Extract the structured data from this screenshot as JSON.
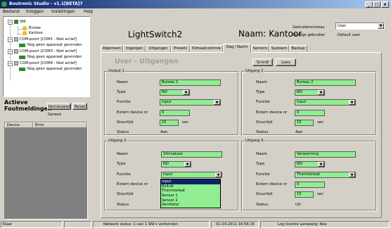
{
  "window": {
    "title": "Boutronic Studio - v1.1[BETA]7",
    "min_btn": "_",
    "max_btn": "□",
    "close_btn": "x"
  },
  "menu": [
    "Bestand",
    "Inloggen",
    "Instellingen",
    "Help"
  ],
  "tree": {
    "root": "SNI",
    "items": [
      {
        "label": "Entree"
      },
      {
        "label": "Kantoor"
      },
      {
        "label": "COM-poort [COM1 - Niet actief]"
      },
      {
        "label": "Nog geen apparaat gevonden"
      },
      {
        "label": "COM-poort [COM3 - Niet actief]"
      },
      {
        "label": "Nog geen apparaat gevonden"
      },
      {
        "label": "COM-poort [COM4 - Niet actief]"
      },
      {
        "label": "Nog geen apparaat gevonden"
      }
    ]
  },
  "alerts": {
    "title_line1": "Actieve",
    "title_line2": "Foutmeldingen",
    "refresh_label": "Vernieuwen",
    "reset_label": "Reset",
    "status": "Gereed",
    "columns": [
      "Device",
      "Error"
    ]
  },
  "header": {
    "device_name": "LightSwitch2",
    "naam": "Naam: Kantoor",
    "user_level_label": "Gebruikersniveau",
    "user_level_value": "User",
    "current_user_label": "Huidige gebruiker",
    "current_user_value": "Default user"
  },
  "tabs": [
    "Algemeen",
    "Ingangen",
    "Uitgangen",
    "Presets",
    "Klimaatcontrole",
    "Dag / Nacht",
    "Sensors",
    "Systeem",
    "Backup"
  ],
  "active_tab": "Dag / Nacht",
  "section": {
    "title": "User - Uitgangen",
    "write_label": "Schrijf",
    "read_label": "Lees"
  },
  "labels": {
    "naam": "Naam",
    "type": "Type",
    "functie": "Functie",
    "extern": "Extern device nr",
    "stuurtijd": "Stuurtijd",
    "status": "Status",
    "sec": "sec"
  },
  "outputs": [
    {
      "title": "Output 1",
      "naam": "Bureau 1",
      "type": "NO",
      "functie": "Input",
      "extern": "0",
      "stuurtijd": "15",
      "status": "Aan"
    },
    {
      "title": "Uitgang 2",
      "naam": "Bureau 2",
      "type": "NO",
      "functie": "Input",
      "extern": "0",
      "stuurtijd": "15",
      "status": "Aan"
    },
    {
      "title": "Uitgang 3",
      "naam": "Vitrinekast",
      "type": "NO",
      "functie": "Input",
      "extern": "",
      "stuurtijd": "",
      "status": ""
    },
    {
      "title": "Uitgang 4",
      "naam": "Verwarming",
      "type": "NO",
      "functie": "Thermostaat",
      "extern": "0",
      "stuurtijd": "15",
      "status": "Uit"
    }
  ],
  "functie_options": [
    "Input",
    "Rolluik",
    "Thermostaat",
    "Sensor 1",
    "Sensor 2",
    "Ventilator"
  ],
  "functie_selected": "Input",
  "statusbar": {
    "state": "Klaar",
    "network": "Netwerk status: 1 van 1 SNI's verbonden",
    "datetime": "01-03-2011 16:56:15",
    "license": "Log licentie aanwezig: Nee"
  },
  "colors": {
    "field_bg": "#90ee90",
    "titlebar": "#0a246a",
    "window_bg": "#d4d0c8"
  }
}
